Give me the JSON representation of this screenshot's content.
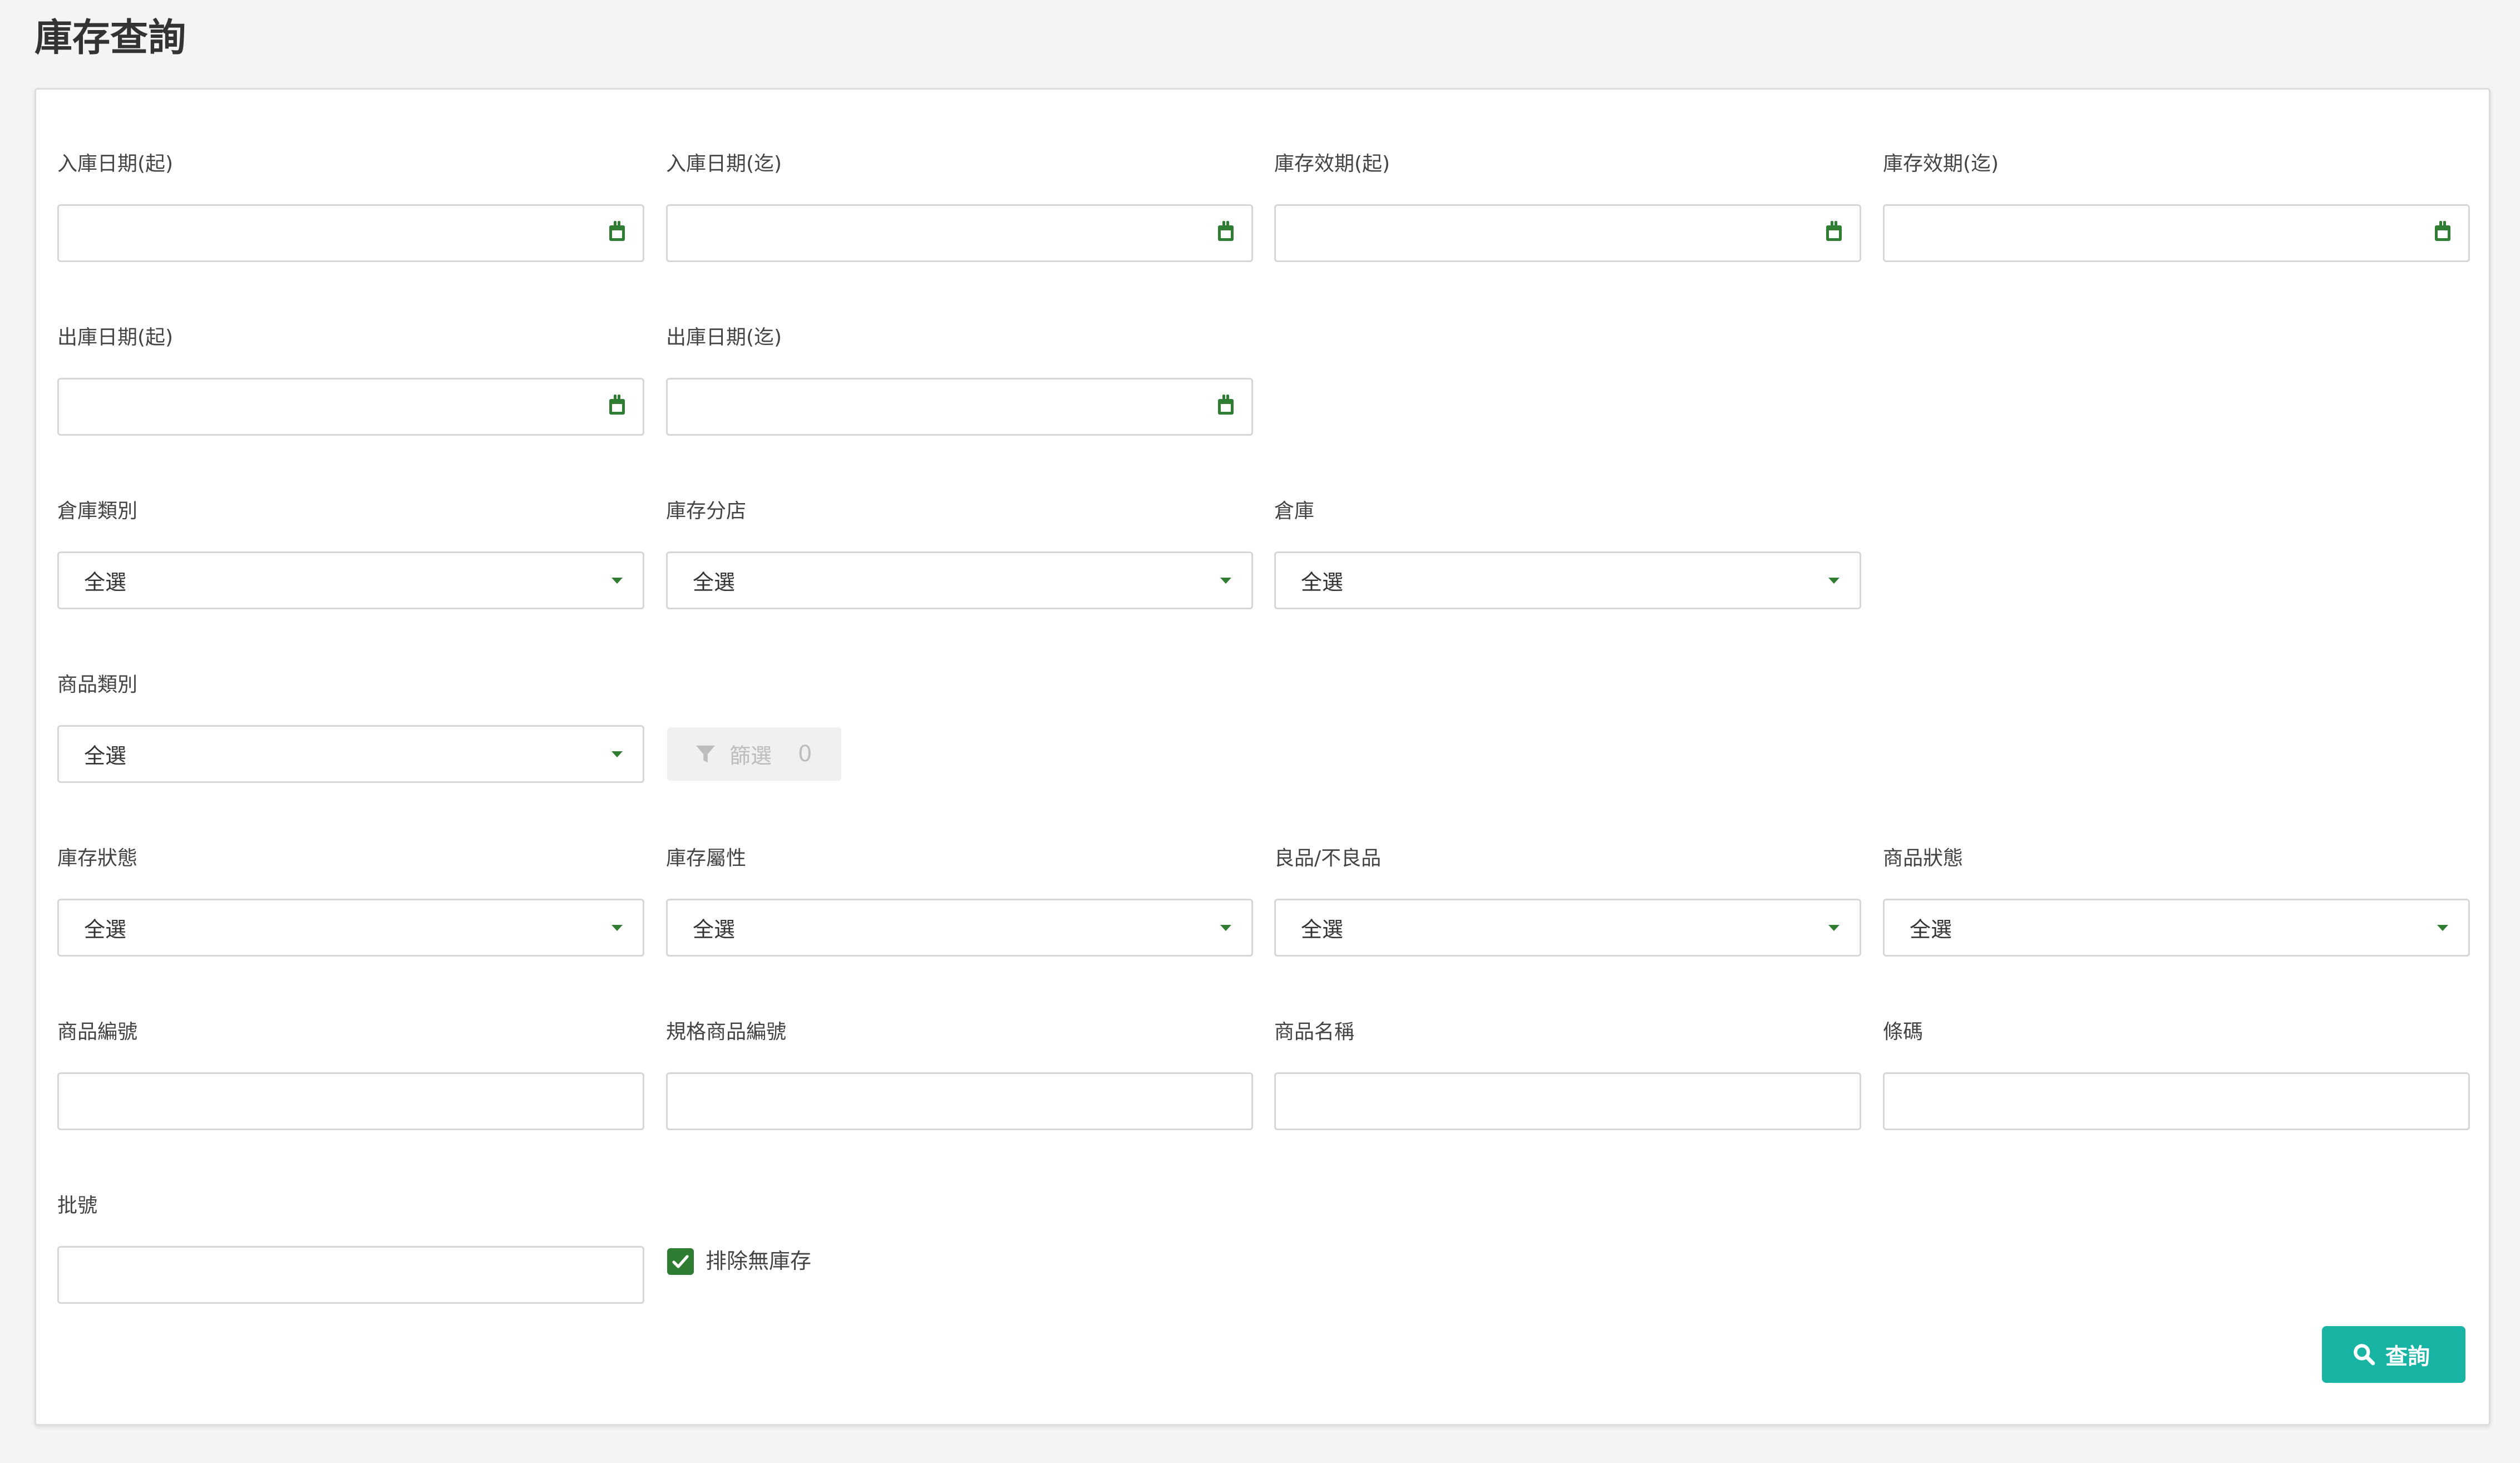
{
  "page": {
    "title": "庫存查詢"
  },
  "fields": {
    "inbound_date_start": {
      "label": "入庫日期(起)",
      "value": ""
    },
    "inbound_date_end": {
      "label": "入庫日期(迄)",
      "value": ""
    },
    "expiry_date_start": {
      "label": "庫存效期(起)",
      "value": ""
    },
    "expiry_date_end": {
      "label": "庫存效期(迄)",
      "value": ""
    },
    "outbound_date_start": {
      "label": "出庫日期(起)",
      "value": ""
    },
    "outbound_date_end": {
      "label": "出庫日期(迄)",
      "value": ""
    },
    "warehouse_type": {
      "label": "倉庫類別",
      "value": "全選"
    },
    "stock_branch": {
      "label": "庫存分店",
      "value": "全選"
    },
    "warehouse": {
      "label": "倉庫",
      "value": "全選"
    },
    "product_category": {
      "label": "商品類別",
      "value": "全選"
    },
    "stock_status": {
      "label": "庫存狀態",
      "value": "全選"
    },
    "stock_attribute": {
      "label": "庫存屬性",
      "value": "全選"
    },
    "good_defective": {
      "label": "良品/不良品",
      "value": "全選"
    },
    "product_status": {
      "label": "商品狀態",
      "value": "全選"
    },
    "product_code": {
      "label": "商品編號",
      "value": ""
    },
    "spec_product_code": {
      "label": "規格商品編號",
      "value": ""
    },
    "product_name": {
      "label": "商品名稱",
      "value": ""
    },
    "barcode": {
      "label": "條碼",
      "value": ""
    },
    "batch_no": {
      "label": "批號",
      "value": ""
    }
  },
  "filter": {
    "label": "篩選",
    "count": "0"
  },
  "exclude_no_stock": {
    "label": "排除無庫存",
    "checked": true
  },
  "search": {
    "label": "查詢"
  },
  "colors": {
    "accent_green": "#2e7d32",
    "search_button": "#17b3a3",
    "border": "#d6d6d6"
  }
}
